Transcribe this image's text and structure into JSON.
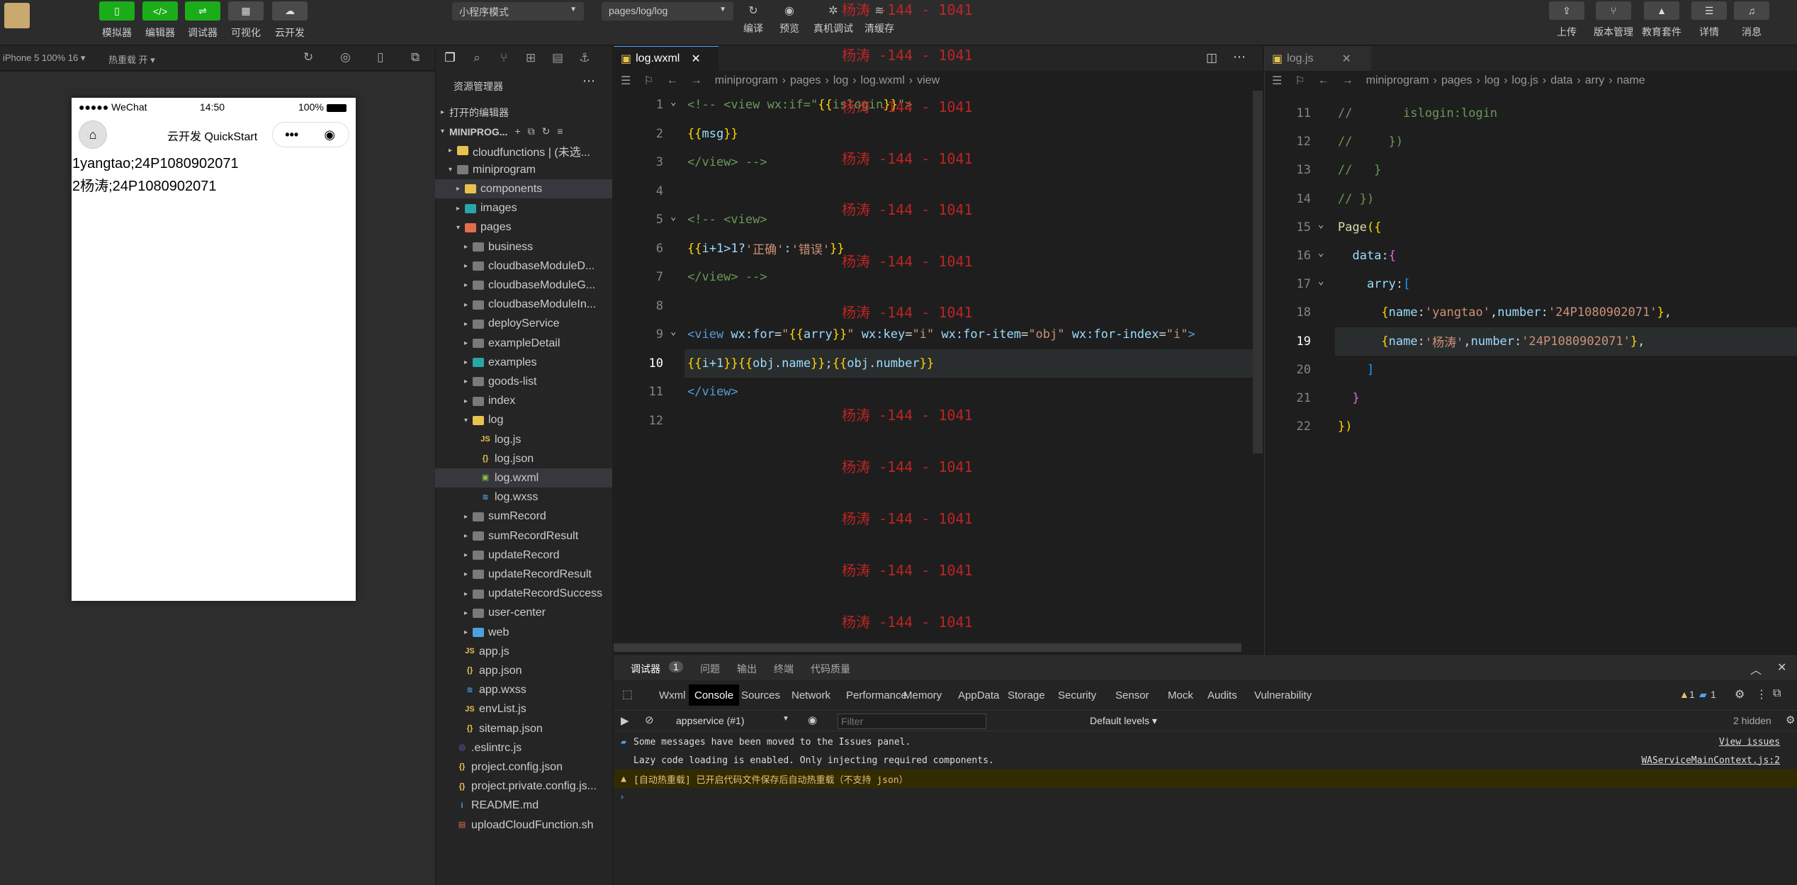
{
  "toolbar": {
    "left_buttons": [
      {
        "label": "模拟器",
        "icon": "phone-icon"
      },
      {
        "label": "编辑器",
        "icon": "code-icon"
      },
      {
        "label": "调试器",
        "icon": "debug-icon"
      },
      {
        "label": "可视化",
        "icon": "layout-icon"
      },
      {
        "label": "云开发",
        "icon": "cloud-icon"
      }
    ],
    "mode_select": "小程序模式",
    "page_select": "pages/log/log",
    "mid_buttons": [
      {
        "label": "编译",
        "icon": "refresh-icon"
      },
      {
        "label": "预览",
        "icon": "eye-icon"
      },
      {
        "label": "真机调试",
        "icon": "bug-icon"
      },
      {
        "label": "清缓存",
        "icon": "layers-icon"
      }
    ],
    "right_buttons": [
      {
        "label": "上传",
        "icon": "upload-icon"
      },
      {
        "label": "版本管理",
        "icon": "branch-icon"
      },
      {
        "label": "教育套件",
        "icon": "graduation-icon"
      },
      {
        "label": "详情",
        "icon": "menu-icon"
      },
      {
        "label": "消息",
        "icon": "bell-icon"
      }
    ]
  },
  "simulator": {
    "device": "iPhone 5 100% 16 ▾",
    "hot_reload": "热重载 开 ▾",
    "status_signal": "●●●●● WeChat",
    "status_time": "14:50",
    "status_battery": "100%",
    "nav_title": "云开发 QuickStart",
    "lines": [
      "1yangtao;24P1080902071",
      "2杨涛;24P1080902071"
    ]
  },
  "explorer": {
    "title": "资源管理器",
    "open_editors": "打开的编辑器",
    "project": "MINIPROG...",
    "items": [
      {
        "label": "cloudfunctions | (未选...",
        "indent": 1,
        "kind": "folder-yellow",
        "arrow": "▸"
      },
      {
        "label": "miniprogram",
        "indent": 1,
        "kind": "folder",
        "arrow": "▾"
      },
      {
        "label": "components",
        "indent": 2,
        "kind": "folder-yellow",
        "arrow": "▸",
        "selected": true
      },
      {
        "label": "images",
        "indent": 2,
        "kind": "folder-teal",
        "arrow": "▸"
      },
      {
        "label": "pages",
        "indent": 2,
        "kind": "folder-red",
        "arrow": "▾"
      },
      {
        "label": "business",
        "indent": 3,
        "kind": "folder",
        "arrow": "▸"
      },
      {
        "label": "cloudbaseModuleD...",
        "indent": 3,
        "kind": "folder",
        "arrow": "▸"
      },
      {
        "label": "cloudbaseModuleG...",
        "indent": 3,
        "kind": "folder",
        "arrow": "▸"
      },
      {
        "label": "cloudbaseModuleIn...",
        "indent": 3,
        "kind": "folder",
        "arrow": "▸"
      },
      {
        "label": "deployService",
        "indent": 3,
        "kind": "folder",
        "arrow": "▸"
      },
      {
        "label": "exampleDetail",
        "indent": 3,
        "kind": "folder",
        "arrow": "▸"
      },
      {
        "label": "examples",
        "indent": 3,
        "kind": "folder-teal",
        "arrow": "▸"
      },
      {
        "label": "goods-list",
        "indent": 3,
        "kind": "folder",
        "arrow": "▸"
      },
      {
        "label": "index",
        "indent": 3,
        "kind": "folder",
        "arrow": "▸"
      },
      {
        "label": "log",
        "indent": 3,
        "kind": "folder-yellow",
        "arrow": "▾"
      },
      {
        "label": "log.js",
        "indent": 4,
        "kind": "js",
        "arrow": ""
      },
      {
        "label": "log.json",
        "indent": 4,
        "kind": "json",
        "arrow": ""
      },
      {
        "label": "log.wxml",
        "indent": 4,
        "kind": "wxml",
        "arrow": "",
        "selected": true
      },
      {
        "label": "log.wxss",
        "indent": 4,
        "kind": "wxss",
        "arrow": ""
      },
      {
        "label": "sumRecord",
        "indent": 3,
        "kind": "folder",
        "arrow": "▸"
      },
      {
        "label": "sumRecordResult",
        "indent": 3,
        "kind": "folder",
        "arrow": "▸"
      },
      {
        "label": "updateRecord",
        "indent": 3,
        "kind": "folder",
        "arrow": "▸"
      },
      {
        "label": "updateRecordResult",
        "indent": 3,
        "kind": "folder",
        "arrow": "▸"
      },
      {
        "label": "updateRecordSuccess",
        "indent": 3,
        "kind": "folder",
        "arrow": "▸"
      },
      {
        "label": "user-center",
        "indent": 3,
        "kind": "folder",
        "arrow": "▸"
      },
      {
        "label": "web",
        "indent": 3,
        "kind": "folder-blue",
        "arrow": "▸"
      },
      {
        "label": "app.js",
        "indent": 2,
        "kind": "js",
        "arrow": ""
      },
      {
        "label": "app.json",
        "indent": 2,
        "kind": "json",
        "arrow": ""
      },
      {
        "label": "app.wxss",
        "indent": 2,
        "kind": "wxss",
        "arrow": ""
      },
      {
        "label": "envList.js",
        "indent": 2,
        "kind": "js",
        "arrow": ""
      },
      {
        "label": "sitemap.json",
        "indent": 2,
        "kind": "json",
        "arrow": ""
      },
      {
        "label": ".eslintrc.js",
        "indent": 1,
        "kind": "eslint",
        "arrow": ""
      },
      {
        "label": "project.config.json",
        "indent": 1,
        "kind": "json",
        "arrow": ""
      },
      {
        "label": "project.private.config.js...",
        "indent": 1,
        "kind": "json",
        "arrow": ""
      },
      {
        "label": "README.md",
        "indent": 1,
        "kind": "info",
        "arrow": ""
      },
      {
        "label": "uploadCloudFunction.sh",
        "indent": 1,
        "kind": "sh",
        "arrow": ""
      }
    ]
  },
  "editor1": {
    "tab": "log.wxml",
    "breadcrumb": [
      "miniprogram",
      "pages",
      "log",
      "log.wxml",
      "view"
    ],
    "watermark": "杨涛 -144 - 1041",
    "lines": [
      {
        "n": "1",
        "tokens": [
          [
            "c-cm",
            "<!-- <view wx:if=\""
          ],
          [
            "c-brace2",
            "{{"
          ],
          [
            "c-cm",
            "islogin"
          ],
          [
            "c-brace2",
            "}}"
          ],
          [
            "c-cm",
            "\">"
          ]
        ]
      },
      {
        "n": "2",
        "tokens": [
          [
            "c-brace2",
            "{{"
          ],
          [
            "c-attr",
            "msg"
          ],
          [
            "c-brace2",
            "}}"
          ]
        ]
      },
      {
        "n": "3",
        "tokens": [
          [
            "c-cm",
            "</view> -->"
          ]
        ]
      },
      {
        "n": "4",
        "tokens": []
      },
      {
        "n": "5",
        "tokens": [
          [
            "c-cm",
            "<!-- <view>"
          ]
        ]
      },
      {
        "n": "6",
        "tokens": [
          [
            "c-brace2",
            "{{"
          ],
          [
            "c-attr",
            "i+1>1?"
          ],
          [
            "c-str",
            "'正确'"
          ],
          [
            "c-attr",
            ":"
          ],
          [
            "c-str",
            "'错误'"
          ],
          [
            "c-brace2",
            "}}"
          ]
        ]
      },
      {
        "n": "7",
        "tokens": [
          [
            "c-cm",
            "</view> -->"
          ]
        ]
      },
      {
        "n": "8",
        "tokens": []
      },
      {
        "n": "9",
        "tokens": [
          [
            "c-tag",
            "<view "
          ],
          [
            "c-attr",
            "wx:for"
          ],
          [
            "c-txt",
            "="
          ],
          [
            "c-str",
            "\""
          ],
          [
            "c-brace2",
            "{{"
          ],
          [
            "c-attr",
            "arry"
          ],
          [
            "c-brace2",
            "}}"
          ],
          [
            "c-str",
            "\""
          ],
          [
            "c-txt",
            " "
          ],
          [
            "c-attr",
            "wx:key"
          ],
          [
            "c-txt",
            "="
          ],
          [
            "c-str",
            "\"i\""
          ],
          [
            "c-txt",
            " "
          ],
          [
            "c-attr",
            "wx:for-item"
          ],
          [
            "c-txt",
            "="
          ],
          [
            "c-str",
            "\"obj\""
          ],
          [
            "c-txt",
            " "
          ],
          [
            "c-attr",
            "wx:for-index"
          ],
          [
            "c-txt",
            "="
          ],
          [
            "c-str",
            "\"i\""
          ],
          [
            "c-tag",
            ">"
          ]
        ]
      },
      {
        "n": "10",
        "tokens": [
          [
            "c-brace2",
            "{{"
          ],
          [
            "c-attr",
            "i+1"
          ],
          [
            "c-brace2",
            "}}"
          ],
          [
            "c-brace2",
            "{{"
          ],
          [
            "c-attr",
            "obj.name"
          ],
          [
            "c-brace2",
            "}}"
          ],
          [
            "c-txt",
            ";"
          ],
          [
            "c-brace2",
            "{{"
          ],
          [
            "c-attr",
            "obj.number"
          ],
          [
            "c-brace2",
            "}}"
          ]
        ],
        "current": true
      },
      {
        "n": "11",
        "tokens": [
          [
            "c-tag",
            "</view>"
          ]
        ]
      },
      {
        "n": "12",
        "tokens": []
      }
    ]
  },
  "editor2": {
    "tab": "log.js",
    "breadcrumb": [
      "miniprogram",
      "pages",
      "log",
      "log.js",
      "data",
      "arry",
      "name"
    ],
    "lines": [
      {
        "n": "11",
        "tokens": [
          [
            "c-cm",
            "//       islogin:login"
          ]
        ]
      },
      {
        "n": "12",
        "tokens": [
          [
            "c-cm",
            "//     })"
          ]
        ]
      },
      {
        "n": "13",
        "tokens": [
          [
            "c-cm",
            "//   }"
          ]
        ]
      },
      {
        "n": "14",
        "tokens": [
          [
            "c-cm",
            "// })"
          ]
        ]
      },
      {
        "n": "15",
        "tokens": [
          [
            "c-fn",
            "Page"
          ],
          [
            "c-brace2",
            "({"
          ]
        ]
      },
      {
        "n": "16",
        "tokens": [
          [
            "c-txt",
            "  "
          ],
          [
            "c-key",
            "data"
          ],
          [
            "c-txt",
            ":"
          ],
          [
            "c-brace",
            "{"
          ]
        ]
      },
      {
        "n": "17",
        "tokens": [
          [
            "c-txt",
            "    "
          ],
          [
            "c-key",
            "arry"
          ],
          [
            "c-txt",
            ":"
          ],
          [
            "c-brace3",
            "["
          ]
        ]
      },
      {
        "n": "18",
        "tokens": [
          [
            "c-txt",
            "      "
          ],
          [
            "c-brace2",
            "{"
          ],
          [
            "c-key",
            "name"
          ],
          [
            "c-txt",
            ":"
          ],
          [
            "c-str",
            "'yangtao'"
          ],
          [
            "c-txt",
            ","
          ],
          [
            "c-key",
            "number"
          ],
          [
            "c-txt",
            ":"
          ],
          [
            "c-str",
            "'24P1080902071'"
          ],
          [
            "c-brace2",
            "}"
          ],
          [
            "c-txt",
            ","
          ]
        ]
      },
      {
        "n": "19",
        "tokens": [
          [
            "c-txt",
            "      "
          ],
          [
            "c-brace2",
            "{"
          ],
          [
            "c-key",
            "name"
          ],
          [
            "c-txt",
            ":"
          ],
          [
            "c-str",
            "'杨涛'"
          ],
          [
            "c-txt",
            ","
          ],
          [
            "c-key",
            "number"
          ],
          [
            "c-txt",
            ":"
          ],
          [
            "c-str",
            "'24P1080902071'"
          ],
          [
            "c-brace2",
            "}"
          ],
          [
            "c-txt",
            ","
          ]
        ],
        "current": true
      },
      {
        "n": "20",
        "tokens": [
          [
            "c-txt",
            "    "
          ],
          [
            "c-brace3",
            "]"
          ]
        ]
      },
      {
        "n": "21",
        "tokens": [
          [
            "c-txt",
            "  "
          ],
          [
            "c-brace",
            "}"
          ]
        ]
      },
      {
        "n": "22",
        "tokens": [
          [
            "c-brace2",
            "})"
          ]
        ]
      }
    ]
  },
  "console": {
    "top_tabs": [
      "调试器",
      "1",
      "问题",
      "输出",
      "终端",
      "代码质量"
    ],
    "devtools_tabs": [
      "Wxml",
      "Console",
      "Sources",
      "Network",
      "Performance",
      "Memory",
      "AppData",
      "Storage",
      "Security",
      "Sensor",
      "Mock",
      "Audits",
      "Vulnerability"
    ],
    "active_tab": "Console",
    "warn_count": "1",
    "msg_count": "1",
    "context": "appservice (#1)",
    "filter_placeholder": "Filter",
    "levels": "Default levels ▾",
    "hidden": "2 hidden",
    "messages": [
      {
        "text": "Some messages have been moved to the Issues panel.",
        "right": "View issues",
        "kind": "info"
      },
      {
        "text": "Lazy code loading is enabled. Only injecting required components.",
        "right": "WAServiceMainContext.js:2",
        "kind": "log"
      },
      {
        "text": "[自动热重载] 已开启代码文件保存后自动热重载（不支持 json）",
        "right": "",
        "kind": "warn"
      }
    ],
    "prompt": "›"
  },
  "colors": {
    "accent": "#1aad19",
    "tab_active": "#4ea1ff",
    "warning": "#e5c07b",
    "watermark": "#d92626"
  }
}
